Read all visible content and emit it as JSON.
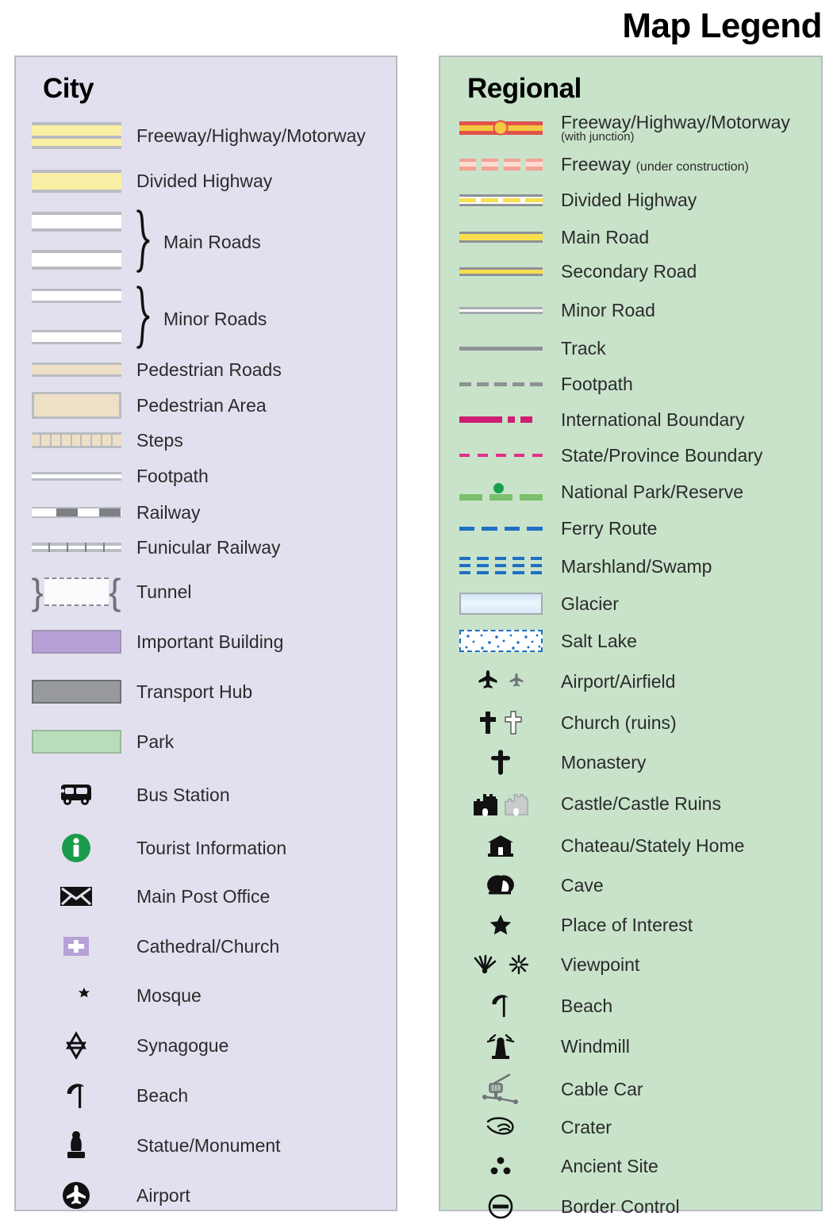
{
  "title": "Map Legend",
  "panels": {
    "city": {
      "heading": "City",
      "background": "#e2e0ee",
      "items": [
        {
          "label": "Freeway/Highway/Motorway",
          "symbol": "city-freeway"
        },
        {
          "label": "Divided Highway",
          "symbol": "city-divided-highway"
        },
        {
          "label": "Main Roads",
          "symbol": "city-main-roads",
          "grouped": true
        },
        {
          "label": "Minor Roads",
          "symbol": "city-minor-roads",
          "grouped": true
        },
        {
          "label": "Pedestrian Roads",
          "symbol": "city-pedestrian-road"
        },
        {
          "label": "Pedestrian Area",
          "symbol": "city-pedestrian-area"
        },
        {
          "label": "Steps",
          "symbol": "city-steps"
        },
        {
          "label": "Footpath",
          "symbol": "city-footpath"
        },
        {
          "label": "Railway",
          "symbol": "city-railway"
        },
        {
          "label": "Funicular Railway",
          "symbol": "city-funicular-railway"
        },
        {
          "label": "Tunnel",
          "symbol": "city-tunnel"
        },
        {
          "label": "Important Building",
          "symbol": "city-important-building"
        },
        {
          "label": "Transport Hub",
          "symbol": "city-transport-hub"
        },
        {
          "label": "Park",
          "symbol": "city-park"
        },
        {
          "label": "Bus Station",
          "symbol": "bus-icon"
        },
        {
          "label": "Tourist Information",
          "symbol": "information-icon"
        },
        {
          "label": "Main Post Office",
          "symbol": "envelope-icon"
        },
        {
          "label": "Cathedral/Church",
          "symbol": "cross-square-icon"
        },
        {
          "label": "Mosque",
          "symbol": "crescent-star-icon"
        },
        {
          "label": "Synagogue",
          "symbol": "star-of-david-icon"
        },
        {
          "label": "Beach",
          "symbol": "parasol-icon"
        },
        {
          "label": "Statue/Monument",
          "symbol": "statue-icon"
        },
        {
          "label": "Airport",
          "symbol": "airport-circle-icon"
        }
      ],
      "colors": {
        "freeway_fill": "#faf0a5",
        "road_casing": "#b9bcc2",
        "road_fill": "#ffffff",
        "pedestrian_fill": "#eee0c6",
        "important_building": "#b6a0d6",
        "transport_hub": "#97999c",
        "park": "#b7ddb9",
        "tourist_info": "#1a9b4c"
      }
    },
    "regional": {
      "heading": "Regional",
      "background": "#c8e3ca",
      "items": [
        {
          "label": "Freeway/Highway/Motorway",
          "sublabel": "(with junction)",
          "symbol": "regional-freeway-junction"
        },
        {
          "label": "Freeway",
          "sublabel": "(under construction)",
          "symbol": "regional-freeway-construction"
        },
        {
          "label": "Divided Highway",
          "symbol": "regional-divided-highway"
        },
        {
          "label": "Main Road",
          "symbol": "regional-main-road"
        },
        {
          "label": "Secondary Road",
          "symbol": "regional-secondary-road"
        },
        {
          "label": "Minor Road",
          "symbol": "regional-minor-road"
        },
        {
          "label": "Track",
          "symbol": "regional-track"
        },
        {
          "label": "Footpath",
          "symbol": "regional-footpath"
        },
        {
          "label": "International Boundary",
          "symbol": "international-boundary"
        },
        {
          "label": "State/Province Boundary",
          "symbol": "state-boundary"
        },
        {
          "label": "National Park/Reserve",
          "symbol": "national-park"
        },
        {
          "label": "Ferry Route",
          "symbol": "ferry-route"
        },
        {
          "label": "Marshland/Swamp",
          "symbol": "marshland"
        },
        {
          "label": "Glacier",
          "symbol": "glacier"
        },
        {
          "label": "Salt Lake",
          "symbol": "salt-lake"
        },
        {
          "label": "Airport/Airfield",
          "symbol": "airplane-icon"
        },
        {
          "label": "Church (ruins)",
          "symbol": "cross-icon"
        },
        {
          "label": "Monastery",
          "symbol": "orthodox-cross-icon"
        },
        {
          "label": "Castle/Castle Ruins",
          "symbol": "castle-icon"
        },
        {
          "label": "Chateau/Stately Home",
          "symbol": "chateau-icon"
        },
        {
          "label": "Cave",
          "symbol": "cave-icon"
        },
        {
          "label": "Place of Interest",
          "symbol": "star-icon"
        },
        {
          "label": "Viewpoint",
          "symbol": "viewpoint-icon"
        },
        {
          "label": "Beach",
          "symbol": "parasol-icon"
        },
        {
          "label": "Windmill",
          "symbol": "windmill-icon"
        },
        {
          "label": "Cable Car",
          "symbol": "cable-car-icon"
        },
        {
          "label": "Crater",
          "symbol": "crater-icon"
        },
        {
          "label": "Ancient Site",
          "symbol": "ancient-site-icon"
        },
        {
          "label": "Border Control",
          "symbol": "border-control-icon"
        }
      ],
      "colors": {
        "freeway_outer": "#e1534a",
        "freeway_inner": "#f6c842",
        "freeway_construction": "#f5a193",
        "road_yellow": "#f7df4e",
        "casing_grey": "#8e9196",
        "international_boundary": "#cf1e72",
        "state_boundary": "#e0308a",
        "national_park": "#7bbf6a",
        "national_park_dot": "#17a04a",
        "ferry": "#1f6fc4",
        "marsh": "#1f6fc4",
        "glacier": "#cfe3f3",
        "salt_lake": "#1f6fc4"
      }
    }
  }
}
